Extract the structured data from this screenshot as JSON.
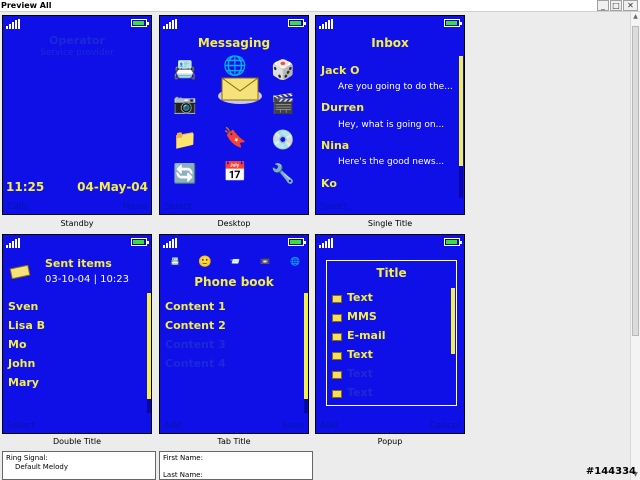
{
  "window": {
    "title": "Preview All"
  },
  "watermark": "#144334",
  "panels": {
    "standby": {
      "caption": "Standby",
      "operator": "Operator",
      "service_provider": "Service provider",
      "time": "11:25",
      "date": "04-May-04",
      "soft_left": "Calls",
      "soft_right": "Menu"
    },
    "desktop": {
      "caption": "Desktop",
      "title": "Messaging",
      "soft_left": "Select"
    },
    "single_title": {
      "caption": "Single Title",
      "title": "Inbox",
      "items": [
        {
          "name": "Jack O",
          "msg": "Are you going to do the..."
        },
        {
          "name": "Durren",
          "msg": "Hey, what is going on..."
        },
        {
          "name": "Nina",
          "msg": "Here's the good news..."
        },
        {
          "name": "Ko",
          "msg": ""
        }
      ],
      "soft_left": "Select"
    },
    "double_title": {
      "caption": "Double Title",
      "title": "Sent items",
      "subtitle": "03-10-04 | 10:23",
      "items": [
        "Sven",
        "Lisa B",
        "Mo",
        "John",
        "Mary"
      ],
      "soft_left": "Select"
    },
    "tab_title": {
      "caption": "Tab Title",
      "title": "Phone book",
      "items": [
        "Content 1",
        "Content 2",
        "Content 3",
        "Content 4"
      ],
      "soft_left": "Add",
      "soft_right": "Save"
    },
    "popup": {
      "caption": "Popup",
      "title": "Title",
      "items": [
        "Text",
        "MMS",
        "E-mail",
        "Text",
        "Text",
        "Text"
      ],
      "soft_left": "Add",
      "soft_right": "Cancel"
    }
  },
  "bottom": {
    "ring_label": "Ring Signal:",
    "ring_value": "Default Melody",
    "first_name": "First Name:",
    "last_name": "Last Name:"
  }
}
